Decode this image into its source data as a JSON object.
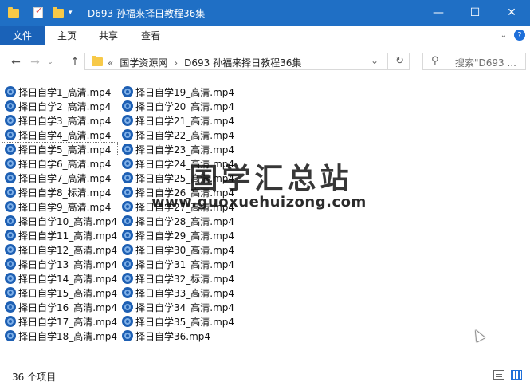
{
  "window": {
    "title": "D693 孙福来择日教程36集",
    "controls": {
      "minimize": "—",
      "maximize": "☐",
      "close": "✕"
    }
  },
  "ribbon": {
    "file_tab": "文件",
    "tabs": [
      "主页",
      "共享",
      "查看"
    ]
  },
  "navigation": {
    "breadcrumb_prefix": "«",
    "breadcrumbs": [
      "国学资源网",
      "D693 孙福来择日教程36集"
    ],
    "search_placeholder": "搜索\"D693 ..."
  },
  "files": {
    "column1": [
      "择日自学1_高清.mp4",
      "择日自学2_高清.mp4",
      "择日自学3_高清.mp4",
      "择日自学4_高清.mp4",
      "择日自学5_高清.mp4",
      "择日自学6_高清.mp4",
      "择日自学7_高清.mp4",
      "择日自学8_标清.mp4",
      "择日自学9_高清.mp4",
      "择日自学10_高清.mp4",
      "择日自学11_高清.mp4",
      "择日自学12_高清.mp4",
      "择日自学13_高清.mp4",
      "择日自学14_高清.mp4",
      "择日自学15_高清.mp4",
      "择日自学16_高清.mp4",
      "择日自学17_高清.mp4",
      "择日自学18_高清.mp4"
    ],
    "column2": [
      "择日自学19_高清.mp4",
      "择日自学20_高清.mp4",
      "择日自学21_高清.mp4",
      "择日自学22_高清.mp4",
      "择日自学23_高清.mp4",
      "择日自学24_高清.mp4",
      "择日自学25_高清.mp4",
      "择日自学26_高清.mp4",
      "择日自学27_高清.mp4",
      "择日自学28_高清.mp4",
      "择日自学29_高清.mp4",
      "择日自学30_高清.mp4",
      "择日自学31_高清.mp4",
      "择日自学32_标清.mp4",
      "择日自学33_高清.mp4",
      "择日自学34_高清.mp4",
      "择日自学35_高清.mp4",
      "择日自学36.mp4"
    ],
    "selected_item": "择日自学5_高清.mp4"
  },
  "watermark": {
    "title": "国学汇总站",
    "url": "www.guoxuehuizong.com"
  },
  "statusbar": {
    "item_count": "36 个项目"
  },
  "colors": {
    "titlebar": "#1f6fc5",
    "file_tab": "#1a62b8",
    "folder": "#f7c948",
    "video_icon": "#1d5fb3"
  }
}
